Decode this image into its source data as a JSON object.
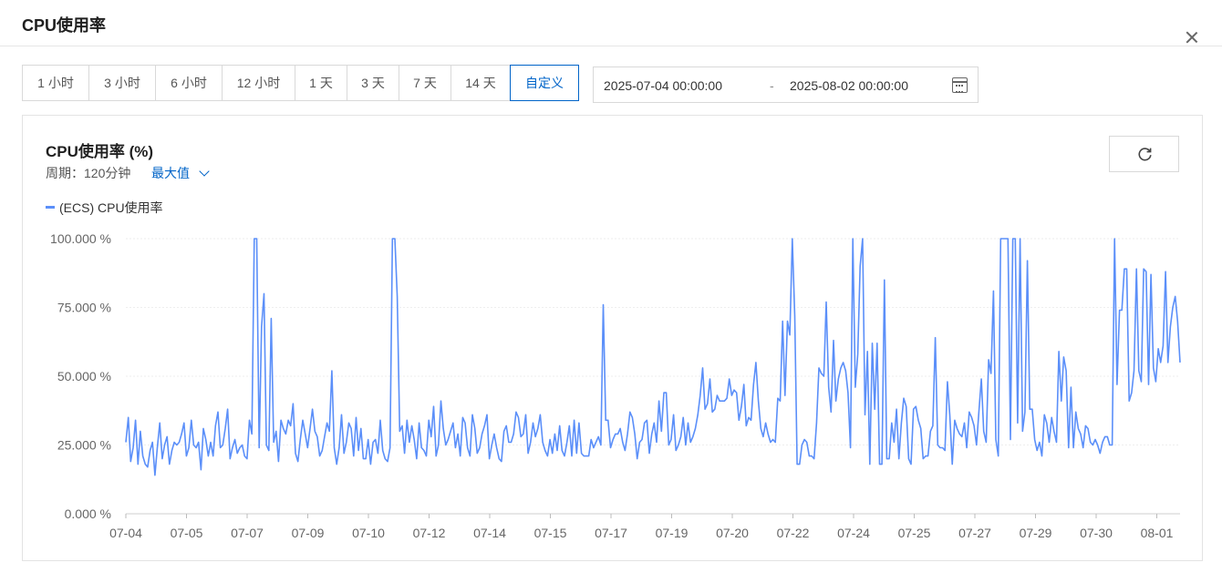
{
  "dialog": {
    "title": "CPU使用率"
  },
  "time_ranges": [
    "1 小时",
    "3 小时",
    "6 小时",
    "12 小时",
    "1 天",
    "3 天",
    "7 天",
    "14 天",
    "自定义"
  ],
  "active_range": "自定义",
  "date_range": {
    "start": "2025-07-04 00:00:00",
    "separator": "-",
    "end": "2025-08-02 00:00:00"
  },
  "panel": {
    "title": "CPU使用率 (%)",
    "period": "周期：120分钟",
    "aggregation": "最大值"
  },
  "colors": {
    "accent": "#0064c8",
    "series": "#5b8ff9"
  },
  "icons": {
    "close": "close-icon",
    "calendar": "calendar-icon",
    "refresh": "refresh-icon",
    "dropdown": "chevron-down-icon"
  },
  "chart_data": {
    "type": "line",
    "title": "CPU使用率 (%)",
    "ylim": [
      0,
      100
    ],
    "y_ticks": [
      "0.000 %",
      "25.000 %",
      "50.000 %",
      "75.000 %",
      "100.000 %"
    ],
    "x_ticks": [
      "07-04",
      "07-05",
      "07-07",
      "07-09",
      "07-10",
      "07-12",
      "07-14",
      "07-15",
      "07-17",
      "07-19",
      "07-20",
      "07-22",
      "07-24",
      "07-25",
      "07-27",
      "07-29",
      "07-30",
      "08-01"
    ],
    "legend_position": "top-left",
    "grid": true,
    "series": [
      {
        "name": "(ECS) CPU使用率",
        "values": [
          26,
          35,
          19,
          24,
          34,
          18,
          30,
          21,
          18,
          17,
          23,
          26,
          14,
          24,
          33,
          20,
          25,
          28,
          18,
          23,
          26,
          25,
          26,
          29,
          33,
          21,
          24,
          34,
          25,
          24,
          26,
          16,
          31,
          27,
          21,
          26,
          21,
          32,
          37,
          24,
          25,
          31,
          38,
          20,
          24,
          27,
          22,
          24,
          25,
          21,
          20,
          34,
          29,
          100,
          100,
          24,
          68,
          80,
          25,
          23,
          71,
          26,
          30,
          19,
          34,
          31,
          29,
          34,
          32,
          40,
          22,
          19,
          27,
          34,
          29,
          24,
          31,
          38,
          30,
          28,
          21,
          23,
          28,
          33,
          30,
          52,
          24,
          18,
          24,
          36,
          22,
          26,
          33,
          31,
          21,
          35,
          23,
          31,
          20,
          20,
          27,
          18,
          26,
          27,
          22,
          34,
          23,
          20,
          19,
          24,
          100,
          100,
          79,
          30,
          32,
          22,
          34,
          26,
          32,
          27,
          20,
          33,
          24,
          23,
          21,
          34,
          28,
          39,
          21,
          25,
          41,
          31,
          25,
          27,
          30,
          33,
          24,
          29,
          21,
          35,
          33,
          24,
          21,
          36,
          31,
          22,
          24,
          29,
          32,
          36,
          20,
          25,
          29,
          24,
          20,
          19,
          30,
          32,
          26,
          26,
          29,
          37,
          35,
          28,
          29,
          36,
          22,
          26,
          33,
          28,
          31,
          36,
          26,
          23,
          21,
          27,
          22,
          29,
          23,
          32,
          23,
          21,
          26,
          32,
          21,
          34,
          22,
          33,
          22,
          21,
          21,
          21,
          27,
          24,
          26,
          28,
          25,
          76,
          34,
          34,
          24,
          27,
          29,
          29,
          31,
          26,
          23,
          29,
          37,
          35,
          29,
          20,
          26,
          27,
          33,
          34,
          22,
          29,
          33,
          26,
          41,
          30,
          44,
          44,
          25,
          27,
          36,
          23,
          25,
          28,
          35,
          25,
          33,
          26,
          28,
          31,
          36,
          43,
          53,
          38,
          40,
          49,
          37,
          38,
          43,
          41,
          41,
          41,
          42,
          49,
          43,
          45,
          44,
          34,
          39,
          47,
          32,
          35,
          34,
          47,
          55,
          41,
          31,
          28,
          33,
          29,
          26,
          27,
          26,
          42,
          41,
          70,
          43,
          70,
          65,
          100,
          72,
          18,
          18,
          25,
          27,
          26,
          21,
          21,
          20,
          33,
          53,
          51,
          50,
          77,
          46,
          37,
          63,
          41,
          49,
          53,
          55,
          52,
          44,
          24,
          100,
          46,
          58,
          90,
          100,
          36,
          59,
          18,
          62,
          38,
          62,
          18,
          18,
          85,
          20,
          20,
          33,
          26,
          38,
          20,
          33,
          42,
          39,
          20,
          18,
          38,
          39,
          34,
          31,
          20,
          21,
          21,
          30,
          32,
          64,
          25,
          24,
          24,
          23,
          48,
          36,
          18,
          34,
          31,
          29,
          28,
          33,
          24,
          37,
          35,
          32,
          25,
          37,
          49,
          30,
          26,
          56,
          51,
          81,
          27,
          21,
          100,
          100,
          100,
          100,
          27,
          100,
          100,
          33,
          100,
          30,
          37,
          92,
          38,
          38,
          27,
          23,
          26,
          21,
          36,
          33,
          26,
          35,
          30,
          26,
          59,
          41,
          57,
          52,
          24,
          46,
          24,
          37,
          31,
          29,
          24,
          32,
          31,
          26,
          25,
          27,
          25,
          22,
          26,
          28,
          28,
          25,
          25,
          100,
          47,
          74,
          74,
          89,
          89,
          41,
          44,
          52,
          89,
          52,
          48,
          89,
          88,
          47,
          87,
          53,
          48,
          60,
          55,
          61,
          88,
          55,
          68,
          75,
          79,
          70,
          55
        ]
      }
    ]
  }
}
